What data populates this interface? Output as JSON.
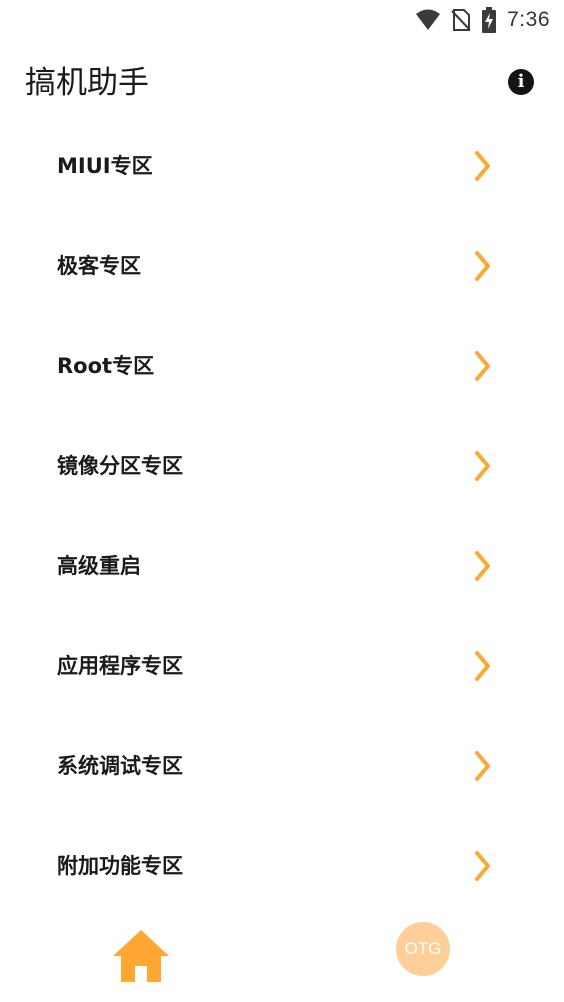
{
  "status_bar": {
    "time": "7:36",
    "icons": [
      "wifi-icon",
      "no-sim-icon",
      "battery-charging-icon"
    ]
  },
  "header": {
    "title": "搞机助手",
    "info_icon": "info-icon",
    "info_glyph": "i"
  },
  "menu": {
    "items": [
      {
        "label": "MIUI专区"
      },
      {
        "label": "极客专区"
      },
      {
        "label": "Root专区"
      },
      {
        "label": "镜像分区专区"
      },
      {
        "label": "高级重启"
      },
      {
        "label": "应用程序专区"
      },
      {
        "label": "系统调试专区"
      },
      {
        "label": "附加功能专区"
      }
    ],
    "chevron_icon": "chevron-right-icon"
  },
  "bottom_nav": {
    "home_icon": "home-icon",
    "otg_label": "OTG"
  },
  "colors": {
    "accent": "#ffa733",
    "otg_bg": "#ffcf9a",
    "text": "#1a1a1a"
  }
}
